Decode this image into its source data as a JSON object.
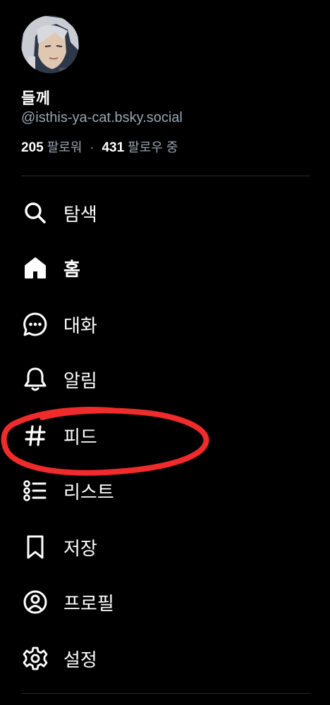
{
  "profile": {
    "display_name": "들께",
    "handle": "@isthis-ya-cat.bsky.social",
    "followers_count": "205",
    "followers_label": "팔로워",
    "separator": "·",
    "following_count": "431",
    "following_label": "팔로우 중"
  },
  "nav": {
    "items": [
      {
        "label": "탐색",
        "icon": "search-icon"
      },
      {
        "label": "홈",
        "icon": "home-icon"
      },
      {
        "label": "대화",
        "icon": "chat-icon"
      },
      {
        "label": "알림",
        "icon": "bell-icon"
      },
      {
        "label": "피드",
        "icon": "hashtag-icon"
      },
      {
        "label": "리스트",
        "icon": "list-icon"
      },
      {
        "label": "저장",
        "icon": "bookmark-icon"
      },
      {
        "label": "프로필",
        "icon": "profile-icon"
      },
      {
        "label": "설정",
        "icon": "gear-icon"
      }
    ]
  },
  "colors": {
    "background": "#000000",
    "text": "#ffffff",
    "muted": "#9aa6b4",
    "annotation": "#ef2b2b"
  }
}
